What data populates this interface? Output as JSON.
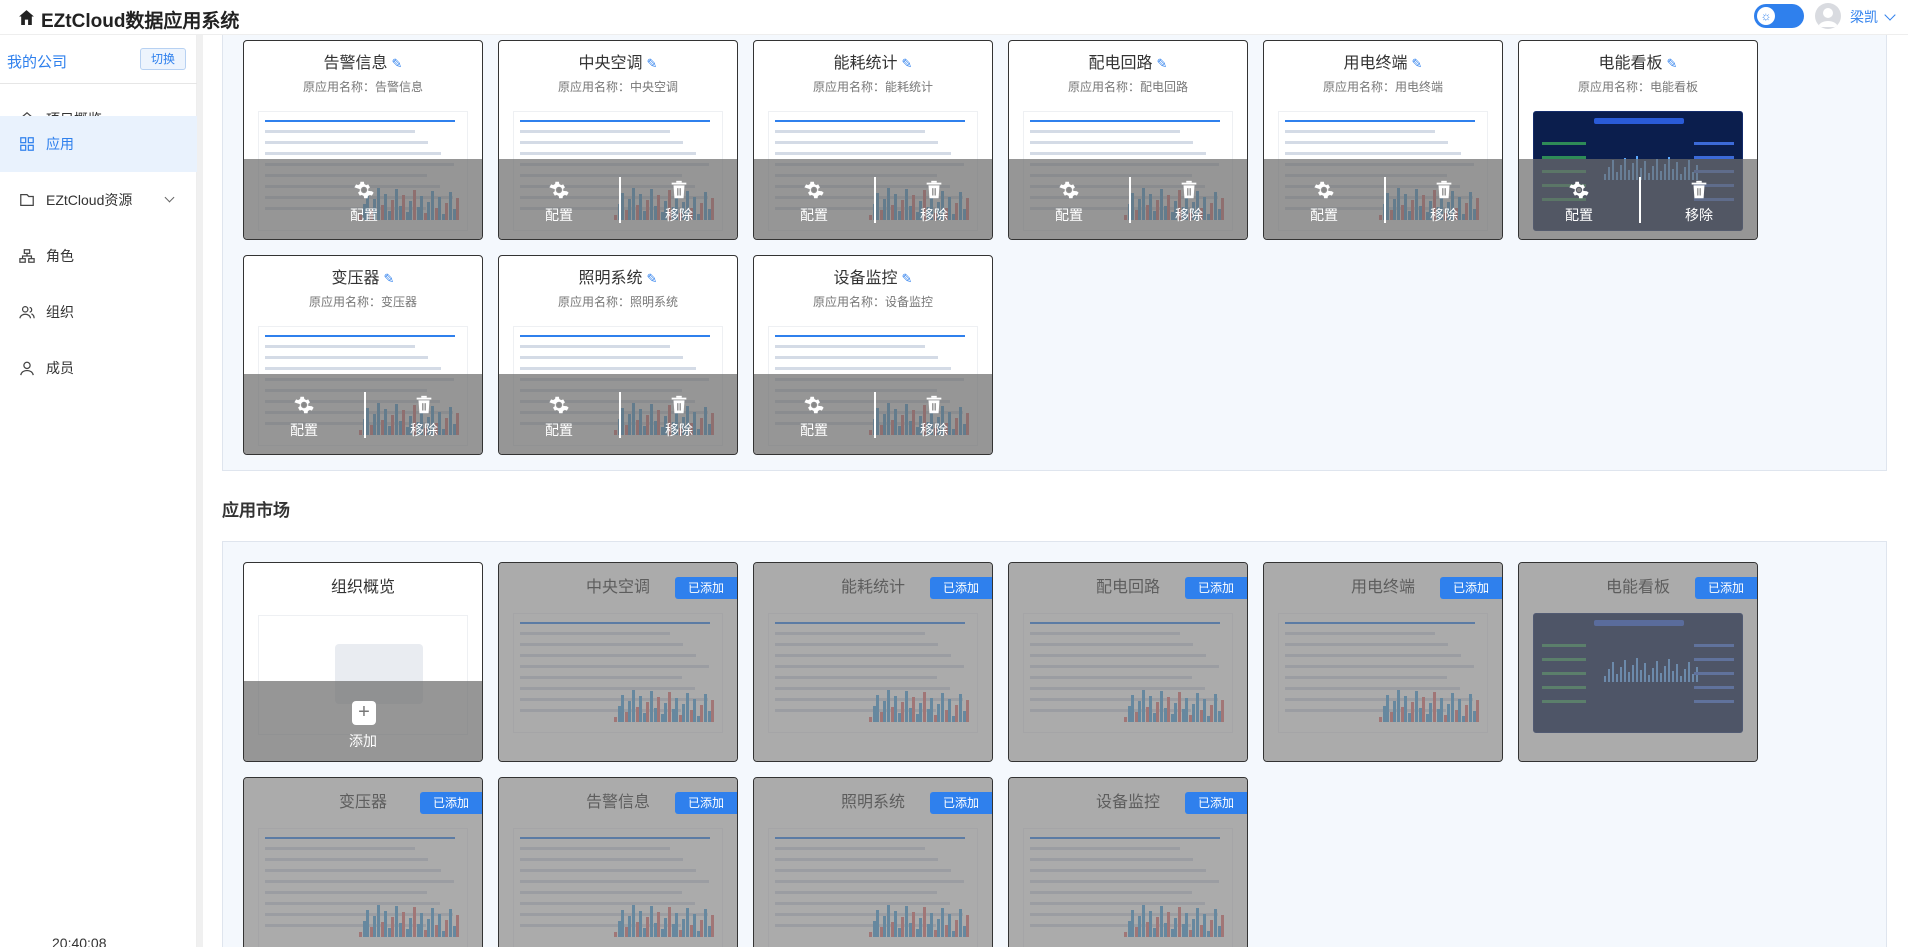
{
  "header": {
    "title": "EZtCloud数据应用系统",
    "user_name": "梁凯"
  },
  "sidebar": {
    "company": "我的公司",
    "switch_label": "切换",
    "items": [
      {
        "label": "项目概览",
        "icon": "home-icon",
        "active": false
      },
      {
        "label": "应用",
        "icon": "grid-icon",
        "active": true
      },
      {
        "label": "EZtCloud资源",
        "icon": "folder-icon",
        "active": false
      },
      {
        "label": "角色",
        "icon": "org-chart-icon",
        "active": false
      },
      {
        "label": "组织",
        "icon": "group-icon",
        "active": false
      },
      {
        "label": "成员",
        "icon": "user-icon",
        "active": false
      }
    ],
    "clock": "20:40:08"
  },
  "installed": {
    "actions": {
      "config": "配置",
      "remove": "移除"
    },
    "apps": [
      {
        "name": "告警信息",
        "original": "原应用名称：告警信息",
        "theme": "light"
      },
      {
        "name": "中央空调",
        "original": "原应用名称：中央空调",
        "theme": "light"
      },
      {
        "name": "能耗统计",
        "original": "原应用名称：能耗统计",
        "theme": "light"
      },
      {
        "name": "配电回路",
        "original": "原应用名称：配电回路",
        "theme": "light"
      },
      {
        "name": "用电终端",
        "original": "原应用名称：用电终端",
        "theme": "light"
      },
      {
        "name": "电能看板",
        "original": "原应用名称：电能看板",
        "theme": "dark"
      },
      {
        "name": "变压器",
        "original": "原应用名称：变压器",
        "theme": "light"
      },
      {
        "name": "照明系统",
        "original": "原应用名称：照明系统",
        "theme": "light"
      },
      {
        "name": "设备监控",
        "original": "原应用名称：设备监控",
        "theme": "light"
      }
    ]
  },
  "market": {
    "title": "应用市场",
    "added_label": "已添加",
    "add_label": "添加",
    "apps": [
      {
        "name": "组织概览",
        "added": false,
        "theme": "empty"
      },
      {
        "name": "中央空调",
        "added": true,
        "theme": "light"
      },
      {
        "name": "能耗统计",
        "added": true,
        "theme": "light"
      },
      {
        "name": "配电回路",
        "added": true,
        "theme": "light"
      },
      {
        "name": "用电终端",
        "added": true,
        "theme": "light"
      },
      {
        "name": "电能看板",
        "added": true,
        "theme": "dark"
      },
      {
        "name": "变压器",
        "added": true,
        "theme": "light"
      },
      {
        "name": "告警信息",
        "added": true,
        "theme": "light"
      },
      {
        "name": "照明系统",
        "added": true,
        "theme": "light"
      },
      {
        "name": "设备监控",
        "added": true,
        "theme": "light"
      }
    ]
  },
  "colors": {
    "accent": "#2f80ed",
    "overlay": "#6e6e6e",
    "panel_bg": "#f4f8fd"
  }
}
